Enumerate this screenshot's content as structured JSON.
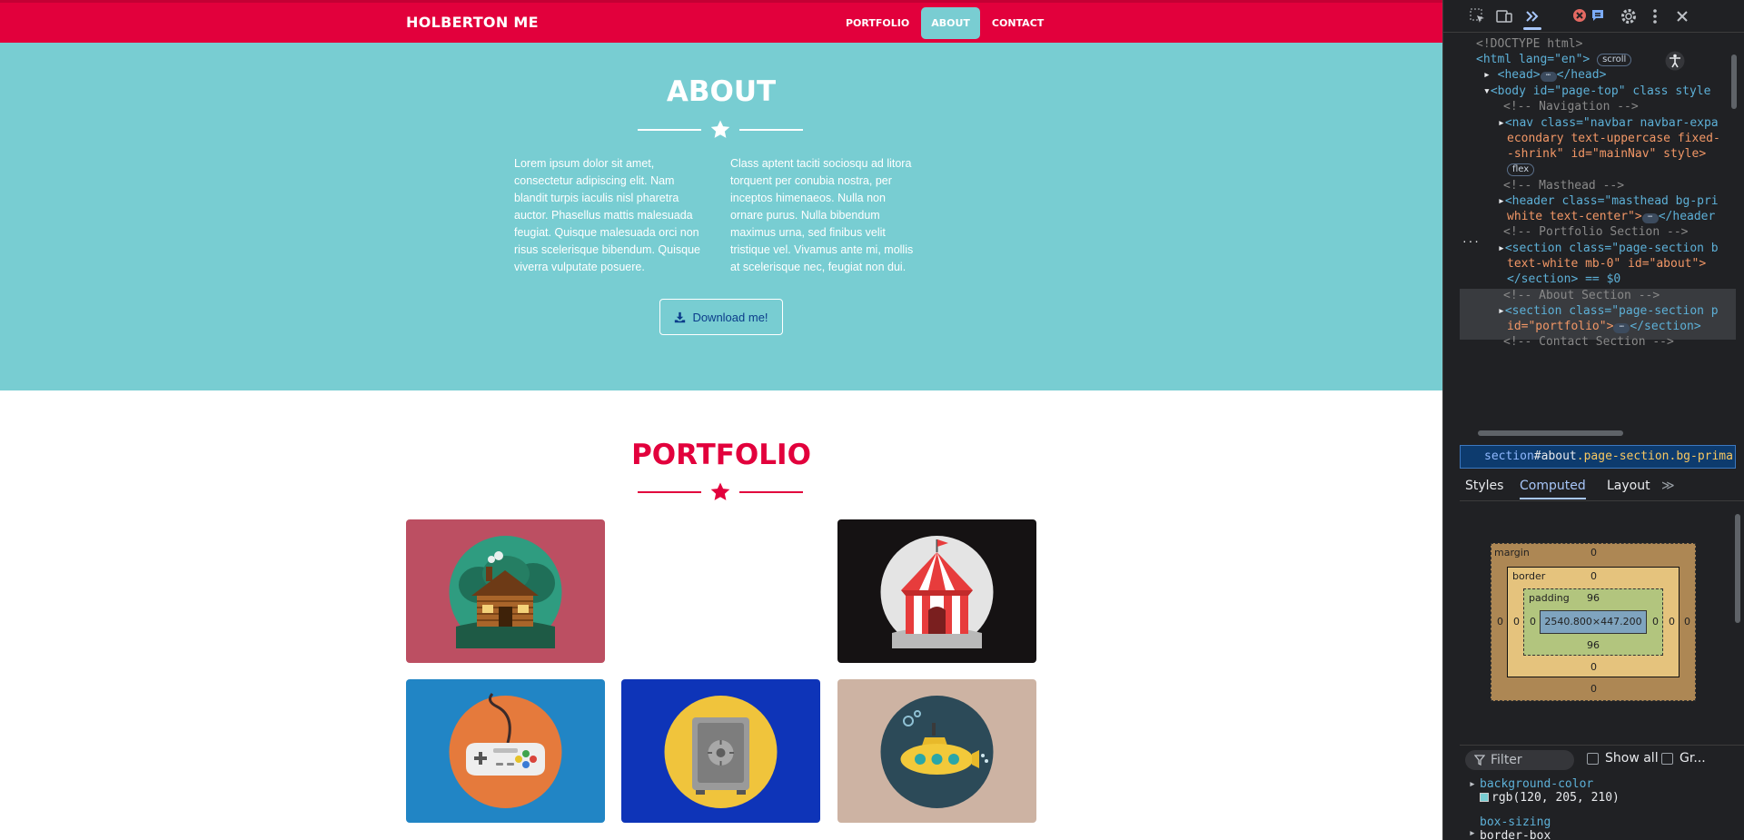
{
  "navbar": {
    "brand": "HOLBERTON ME",
    "links": [
      "PORTFOLIO",
      "ABOUT",
      "CONTACT"
    ],
    "active_link": "ABOUT"
  },
  "about": {
    "title": "ABOUT",
    "col_left": "Lorem ipsum dolor sit amet, consectetur adipiscing elit. Nam blandit turpis iaculis nisl pharetra auctor. Phasellus mattis malesuada feugiat. Quisque malesuada orci non risus scelerisque bibendum. Quisque viverra vulputate posuere.",
    "col_right": "Class aptent taciti sociosqu ad litora torquent per conubia nostra, per inceptos himenaeos. Nulla non ornare purus. Nulla bibendum maximus urna, sed finibus velit tristique vel. Vivamus ante mi, mollis at scelerisque nec, feugiat non dui.",
    "download_label": "Download me!",
    "background": "#78cdd2"
  },
  "portfolio": {
    "title": "PORTFOLIO",
    "accent": "#e2003c",
    "tiles": [
      {
        "name": "cabin",
        "bg": "#bc4f62"
      },
      {
        "name": "circus-tent",
        "bg": "#151213"
      },
      {
        "name": "game-controller",
        "bg": "#2185c5"
      },
      {
        "name": "safe",
        "bg": "#0e34b8"
      },
      {
        "name": "submarine",
        "bg": "#cdb3a3"
      }
    ]
  },
  "devtools": {
    "tree": {
      "doctype": "<!DOCTYPE html>",
      "html_open": "<html lang=\"en\">",
      "scroll_badge": "scroll",
      "head": "<head>",
      "head_close": "</head>",
      "body": "<body id=\"page-top\" class style",
      "c_nav": "<!-- Navigation -->",
      "nav_line1": "<nav class=\"navbar navbar-expa",
      "nav_line2": "econdary text-uppercase fixed-",
      "nav_line3": "-shrink\" id=\"mainNav\" style>",
      "flex_badge": "flex",
      "c_masthead": "<!-- Masthead -->",
      "header_line1": "<header class=\"masthead bg-pri",
      "header_line2": "white text-center\">",
      "header_close": "</header",
      "c_portfolio": "<!-- Portfolio Section -->",
      "section1_line1": "<section class=\"page-section b",
      "section1_line2": "text-white mb-0\" id=\"about\">",
      "section1_line3": "</section> == $0",
      "c_about": "<!-- About Section -->",
      "section2_line1": "<section class=\"page-section p",
      "section2_line2": "id=\"portfolio\">",
      "section2_close": "</section>",
      "c_contact": "<!-- Contact Section -->"
    },
    "breadcrumb": {
      "tag": "section",
      "id": "#about",
      "classes": ".page-section.bg-prima"
    },
    "tabs": [
      "Styles",
      "Computed",
      "Layout"
    ],
    "active_tab": "Computed",
    "box_model": {
      "margin_label": "margin",
      "margin_top": "0",
      "margin_bottom": "0",
      "margin_left": "0",
      "margin_right": "0",
      "border_label": "border",
      "border_top": "0",
      "border_bottom": "0",
      "border_left": "0",
      "border_right": "0",
      "padding_label": "padding",
      "padding_top": "96",
      "padding_bottom": "96",
      "padding_left": "0",
      "padding_right": "0",
      "content": "2540.800×447.200"
    },
    "filter_placeholder": "Filter",
    "show_all_label": "Show all",
    "group_label": "Gr...",
    "properties": [
      {
        "name": "background-color",
        "value": "rgb(120, 205, 210)",
        "swatch": "#78cdd2"
      },
      {
        "name": "box-sizing",
        "value": "border-box"
      }
    ]
  }
}
